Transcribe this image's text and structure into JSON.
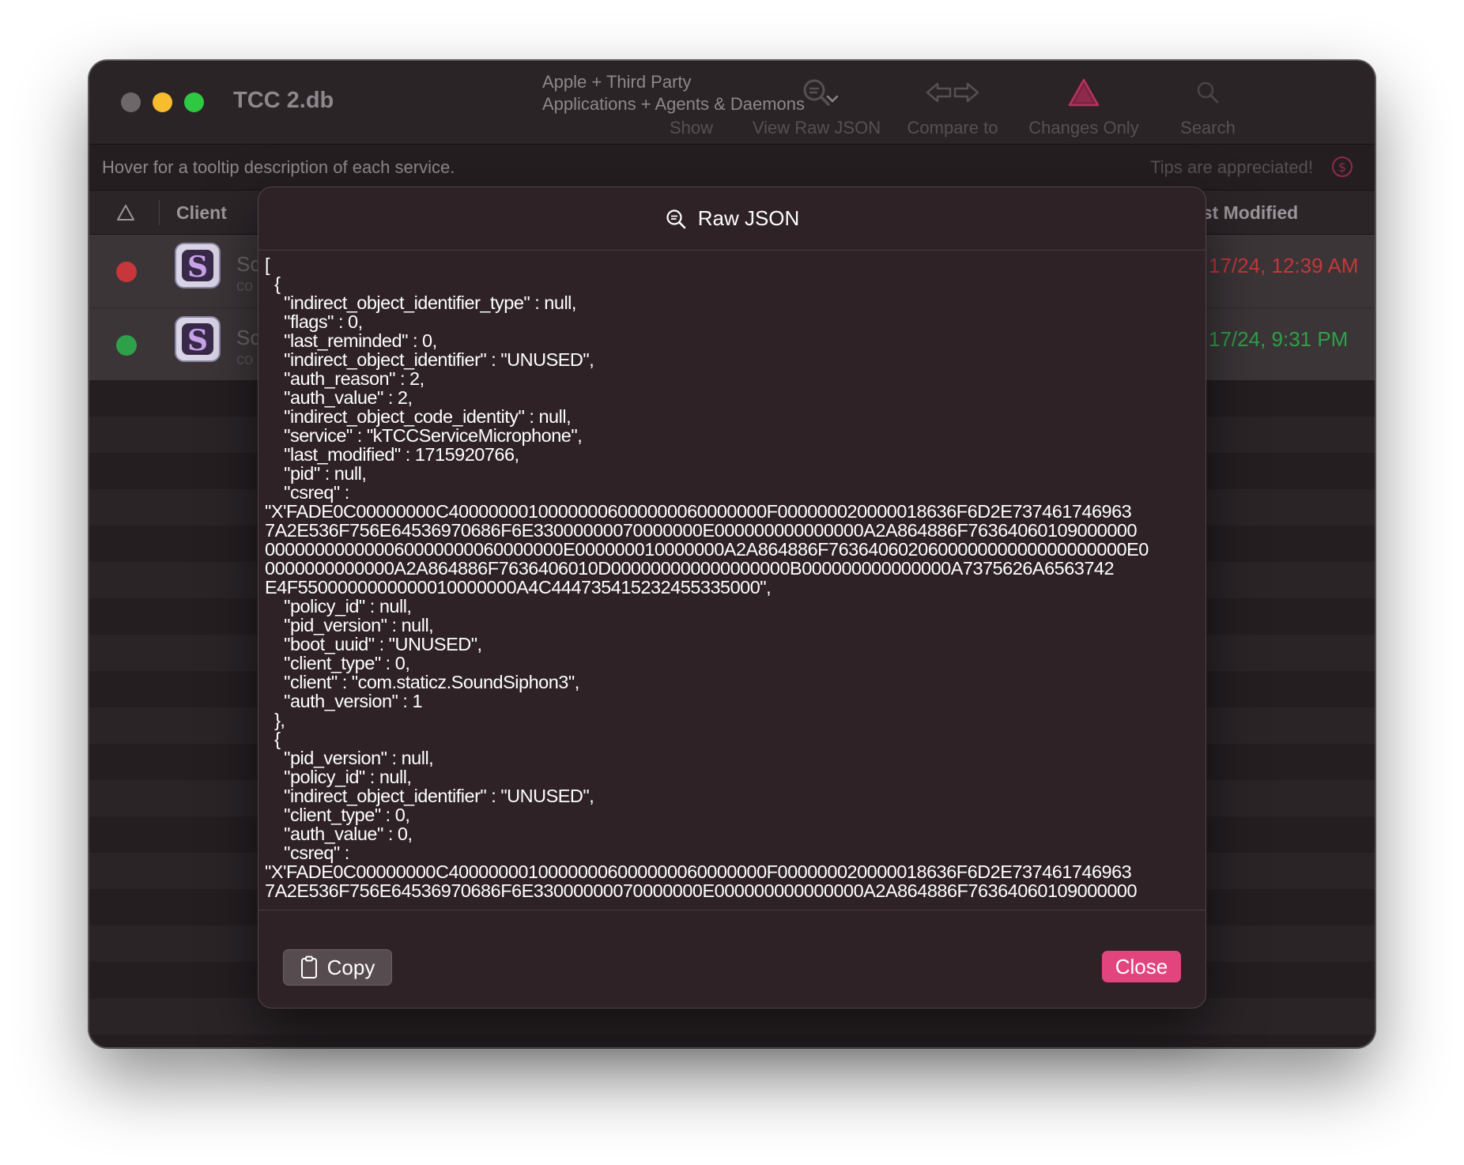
{
  "window": {
    "title": "TCC 2.db",
    "scope_line1": "Apple + Third Party",
    "scope_line2": "Applications + Agents & Daemons",
    "scope_show_label": "Show"
  },
  "toolbar": {
    "view_raw_json": "View Raw JSON",
    "compare_to": "Compare to",
    "changes_only": "Changes Only",
    "search": "Search"
  },
  "infobar": {
    "hint": "Hover for a tooltip description of each service.",
    "tips": "Tips are appreciated!"
  },
  "table": {
    "col_client": "Client",
    "col_last_modified": "ast Modified",
    "rows": [
      {
        "name": "Sc",
        "sub": "co",
        "date": "17/24, 12:39 AM",
        "status_color": "#c6363a",
        "date_color": "#c6363a"
      },
      {
        "name": "Sc",
        "sub": "co",
        "date": "17/24, 9:31 PM",
        "status_color": "#2ea04a",
        "date_color": "#2ea04a"
      }
    ]
  },
  "modal": {
    "title": "Raw JSON",
    "json_text": "[\n  {\n    \"indirect_object_identifier_type\" : null,\n    \"flags\" : 0,\n    \"last_reminded\" : 0,\n    \"indirect_object_identifier\" : \"UNUSED\",\n    \"auth_reason\" : 2,\n    \"auth_value\" : 2,\n    \"indirect_object_code_identity\" : null,\n    \"service\" : \"kTCCServiceMicrophone\",\n    \"last_modified\" : 1715920766,\n    \"pid\" : null,\n    \"csreq\" :\n\"X'FADE0C00000000C40000000100000006000000060000000F000000020000018636F6D2E737461746963\n7A2E536F756E64536970686F6E33000000070000000E000000000000000A2A864886F76364060109000000\n000000000000060000000060000000E000000010000000A2A864886F763640602060000000000000000000E0\n0000000000000A2A864886F7636406010D000000000000000000B000000000000000A7375626A6563742\nE4F5500000000000010000000A4C444735415232455335000\",\n    \"policy_id\" : null,\n    \"pid_version\" : null,\n    \"boot_uuid\" : \"UNUSED\",\n    \"client_type\" : 0,\n    \"client\" : \"com.staticz.SoundSiphon3\",\n    \"auth_version\" : 1\n  },\n  {\n    \"pid_version\" : null,\n    \"policy_id\" : null,\n    \"indirect_object_identifier\" : \"UNUSED\",\n    \"client_type\" : 0,\n    \"auth_value\" : 0,\n    \"csreq\" :\n\"X'FADE0C00000000C40000000100000006000000060000000F000000020000018636F6D2E737461746963\n7A2E536F756E64536970686F6E33000000070000000E000000000000000A2A864886F76364060109000000",
    "copy_label": "Copy",
    "close_label": "Close"
  },
  "colors": {
    "accent": "#e2457e",
    "window_bg": "#241e21",
    "modal_bg": "#2e2226"
  },
  "icons": {
    "view_raw_json": "magnifier-braces-icon",
    "compare_to": "arrows-left-right-icon",
    "changes_only": "warning-triangle-icon",
    "search": "search-icon",
    "tips": "dollar-circle-icon",
    "copy": "clipboard-icon",
    "sort": "sort-triangle-icon"
  }
}
